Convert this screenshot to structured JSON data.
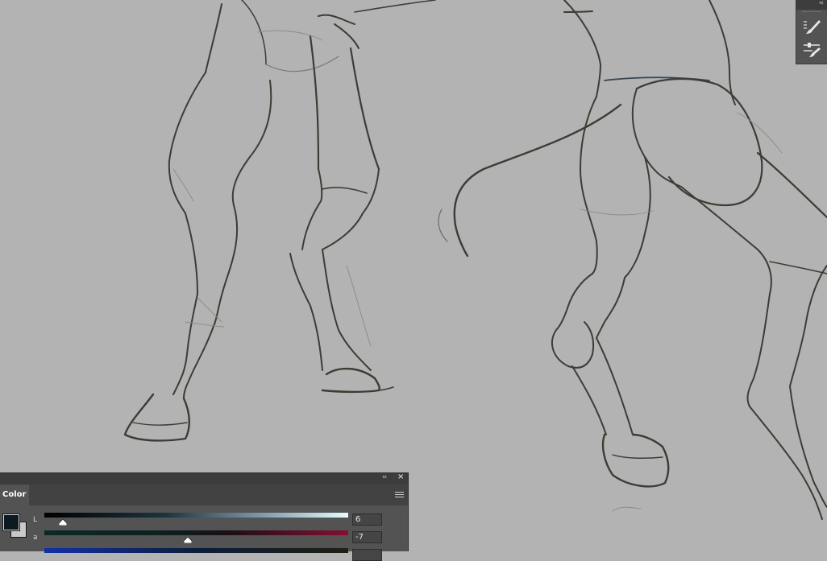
{
  "color_panel": {
    "tab_label": "Color",
    "sliders": [
      {
        "label": "L",
        "value": "6"
      },
      {
        "label": "a",
        "value": "-7"
      },
      {
        "label": "",
        "value": ""
      }
    ]
  },
  "icons": {
    "panel_collapse": "‹‹",
    "panel_close": "×",
    "strip_collapse": "‹‹"
  },
  "colors": {
    "foreground": "#0d1a20",
    "background": "#c9c9c9",
    "canvas": "#b3b3b3"
  }
}
